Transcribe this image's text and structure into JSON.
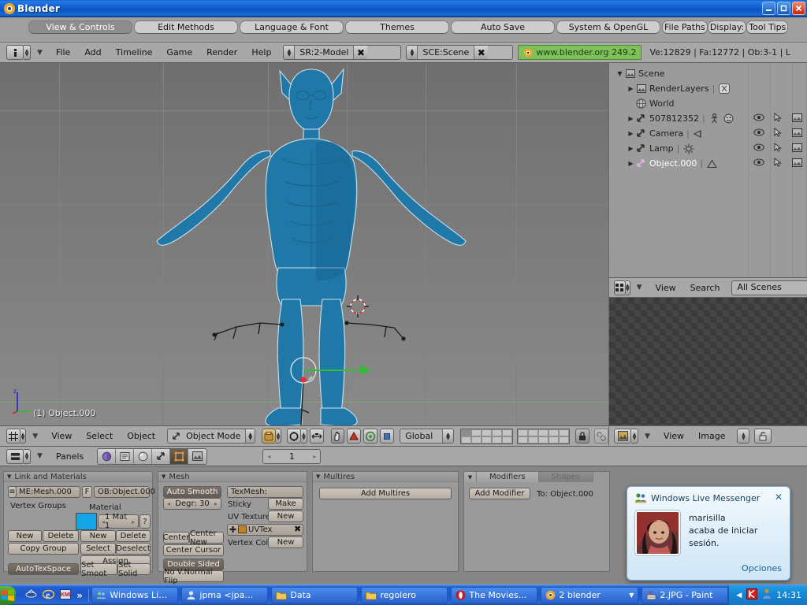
{
  "window": {
    "title": "Blender",
    "minimize_label": "_",
    "maximize_label": "❐",
    "close_label": "✕"
  },
  "prefs_tabs": [
    {
      "label": "View & Controls",
      "active": true
    },
    {
      "label": "Edit Methods",
      "active": false
    },
    {
      "label": "Language & Font",
      "active": false
    },
    {
      "label": "Themes",
      "active": false
    },
    {
      "label": "Auto Save",
      "active": false
    },
    {
      "label": "System & OpenGL",
      "active": false
    },
    {
      "label": "File Paths",
      "active": false
    },
    {
      "label": "Display:",
      "active": false
    },
    {
      "label": "Tool Tips",
      "active": false
    }
  ],
  "header": {
    "window_type_icon": "info-editor-icon",
    "menus": [
      "File",
      "Add",
      "Timeline",
      "Game",
      "Render",
      "Help"
    ],
    "screen_field": "SR:2-Model",
    "scene_field": "SCE:Scene",
    "version_link": "www.blender.org 249.2",
    "stats": "Ve:12829 | Fa:12772 | Ob:3-1 | L"
  },
  "viewport": {
    "object_label": "(1) Object.000",
    "axis_z_label": "z",
    "model_color": "#1f78a8",
    "outline_color": "#c8e2f0",
    "background_top": "#6f6f6f",
    "background_bottom": "#8a8a8a"
  },
  "outliner": {
    "rows": [
      {
        "indent": 0,
        "tri": "",
        "icon": "scene-icon",
        "name": "Scene",
        "extra": "",
        "selected": false,
        "cols": false
      },
      {
        "indent": 1,
        "tri": "▶",
        "icon": "renderlayer-icon",
        "name": "RenderLayers",
        "extra": "renderlayer-badge-icon",
        "selected": false,
        "cols": false
      },
      {
        "indent": 1,
        "tri": "",
        "icon": "world-icon",
        "name": "World",
        "extra": "",
        "selected": false,
        "cols": false
      },
      {
        "indent": 1,
        "tri": "▶",
        "icon": "object-icon",
        "name": "507812352",
        "extra": "armature-icon",
        "extra2": "face-icon",
        "selected": false,
        "cols": true
      },
      {
        "indent": 1,
        "tri": "▶",
        "icon": "object-icon",
        "name": "Camera",
        "extra": "camera-icon",
        "selected": false,
        "cols": true
      },
      {
        "indent": 1,
        "tri": "▶",
        "icon": "object-icon",
        "name": "Lamp",
        "extra": "lamp-icon",
        "selected": false,
        "cols": true
      },
      {
        "indent": 1,
        "tri": "▶",
        "icon": "object-icon",
        "name": "Object.000",
        "extra": "mesh-icon",
        "selected": true,
        "cols": true
      }
    ],
    "header": {
      "editor_icon": "outliner-editor-icon",
      "menus": [
        "View",
        "Search"
      ],
      "scope": "All Scenes"
    }
  },
  "image_editor": {
    "editor_icon": "uv-image-editor-icon",
    "menus": [
      "View",
      "Image"
    ],
    "lock_icon": "unlock-icon"
  },
  "view3d_header": {
    "editor_icon": "view3d-editor-icon",
    "menus": [
      "View",
      "Select",
      "Object"
    ],
    "mode": "Object Mode",
    "draw_type_icon": "solid-shading-icon",
    "pivot_icon": "pivot-median-icon",
    "widgets": [
      "hand-icon",
      "rotate-manip-icon",
      "scale-manip-icon",
      "translate-manip-icon"
    ],
    "orientation": "Global",
    "lock_icon": "lock-icon",
    "link_icon": "link-scene-icon",
    "layers_first_active": true
  },
  "buttons_header": {
    "editor_icon": "buttons-editor-icon",
    "menus": [
      "Panels"
    ],
    "context_icons": [
      "shading-icon",
      "object-icon",
      "material-icon",
      "object-data-icon",
      "editing-icon",
      "scene-icon"
    ],
    "active_context_index": 4,
    "frame_value": "1",
    "frame_prev": "◂",
    "frame_next": "▸"
  },
  "panels": {
    "link_and_materials": {
      "title": "Link and Materials",
      "mesh_field": "ME:Mesh.000",
      "f_button": "F",
      "object_field": "OB:Object.000",
      "vertex_groups_label": "Vertex Groups",
      "material_label": "Material",
      "material_swatch": "#12a5e8",
      "material_index": "1 Mat 1",
      "help_button": "?",
      "vg_new": "New",
      "vg_delete": "Delete",
      "copy_group": "Copy Group",
      "mat_new": "New",
      "mat_delete": "Delete",
      "mat_select": "Select",
      "mat_deselect": "Deselect",
      "mat_assign": "Assign",
      "autotexspace": "AutoTexSpace",
      "set_smooth": "Set Smoot",
      "set_solid": "Set Solid"
    },
    "mesh": {
      "title": "Mesh",
      "auto_smooth": "Auto Smooth",
      "degr": "Degr: 30",
      "center": "Center",
      "center_new": "Center New",
      "center_cursor": "Center Cursor",
      "double_sided": "Double Sided",
      "no_vnormal_flip": "No V.Normal Flip",
      "texmesh": "TexMesh:",
      "sticky_label": "Sticky",
      "sticky_button": "Make",
      "uv_texture_label": "UV Texture",
      "uv_texture_button": "New",
      "uv_layer": "UVTex",
      "uv_layer_delete": "✖",
      "vertex_color_label": "Vertex Color",
      "vertex_color_button": "New"
    },
    "multires": {
      "title": "Multires",
      "add_button": "Add Multires"
    },
    "modifiers": {
      "tab_modifiers": "Modifiers",
      "tab_shapes": "Shapes",
      "add_modifier": "Add Modifier",
      "target": "To: Object.000"
    }
  },
  "msn_popup": {
    "icon": "messenger-icon",
    "title": "Windows Live Messenger",
    "close": "✕",
    "contact": "marisilla",
    "line2": "acaba de iniciar",
    "line3": "sesión.",
    "options": "Opciones"
  },
  "taskbar": {
    "start_label": "",
    "quick_launch": [
      "show-desktop-icon",
      "internet-explorer-icon",
      "kmplayer-icon",
      "more-chevrons-icon"
    ],
    "tasks": [
      {
        "icon": "messenger-icon",
        "label": "Windows Li…",
        "grouped": false
      },
      {
        "icon": "contact-icon",
        "label": "jpma <jpa…",
        "grouped": false
      },
      {
        "icon": "folder-icon",
        "label": "Data",
        "grouped": false
      },
      {
        "icon": "folder-icon",
        "label": "regolero",
        "grouped": false
      },
      {
        "icon": "opera-icon",
        "label": "The Movies…",
        "grouped": false
      },
      {
        "icon": "blender-icon",
        "label": "2 blender",
        "grouped": true
      },
      {
        "icon": "paint-icon",
        "label": "2.JPG - Paint",
        "grouped": false
      }
    ],
    "tray_icons": [
      "tray-chevron-icon",
      "kaspersky-icon",
      "user-icon"
    ],
    "clock": "14:31"
  }
}
